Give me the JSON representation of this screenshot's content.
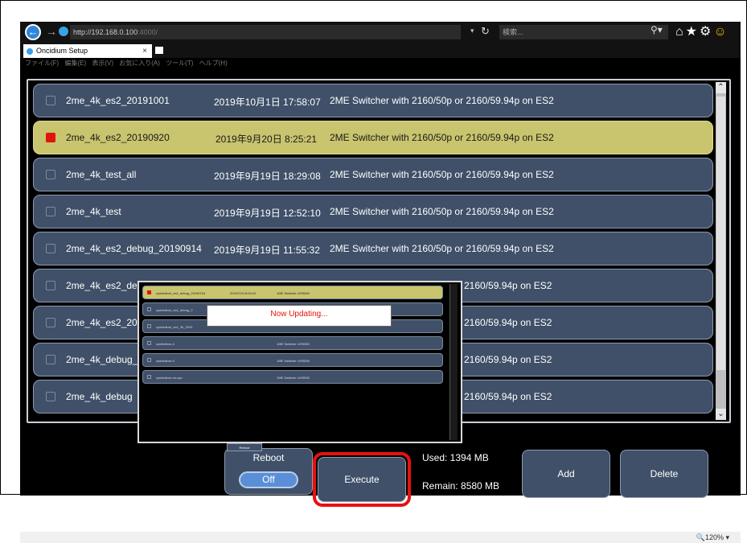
{
  "browser": {
    "url_host": "http://192.168.0.100",
    "url_rest": ":4000/",
    "search_placeholder": "検索...",
    "tab_title": "Oncidium Setup",
    "tab_close": "×",
    "menu": [
      "ファイル(F)",
      "編集(E)",
      "表示(V)",
      "お気に入り(A)",
      "ツール(T)",
      "ヘルプ(H)"
    ],
    "toolbar_icons": [
      "home-icon",
      "star-icon",
      "gear-icon",
      "smiley-icon"
    ],
    "zoom": "120%"
  },
  "list": {
    "rows": [
      {
        "name": "2me_4k_es2_20191001",
        "date": "2019年10月1日 17:58:07",
        "desc": "2ME Switcher with 2160/50p or 2160/59.94p on ES2",
        "selected": false
      },
      {
        "name": "2me_4k_es2_20190920",
        "date": "2019年9月20日 8:25:21",
        "desc": "2ME Switcher with 2160/50p or 2160/59.94p on ES2",
        "selected": true
      },
      {
        "name": "2me_4k_test_all",
        "date": "2019年9月19日 18:29:08",
        "desc": "2ME Switcher with 2160/50p or 2160/59.94p on ES2",
        "selected": false
      },
      {
        "name": "2me_4k_test",
        "date": "2019年9月19日 12:52:10",
        "desc": "2ME Switcher with 2160/50p or 2160/59.94p on ES2",
        "selected": false
      },
      {
        "name": "2me_4k_es2_debug_20190914",
        "date": "2019年9月19日 11:55:32",
        "desc": "2ME Switcher with 2160/50p or 2160/59.94p on ES2",
        "selected": false
      },
      {
        "name": "2me_4k_es2_de",
        "date": "",
        "desc": "2160/59.94p on ES2",
        "selected": false
      },
      {
        "name": "2me_4k_es2_20",
        "date": "",
        "desc": "2160/59.94p on ES2",
        "selected": false
      },
      {
        "name": "2me_4k_debug_",
        "date": "",
        "desc": "2160/59.94p on ES2",
        "selected": false
      },
      {
        "name": "2me_4k_debug",
        "date": "",
        "desc": "2160/59.94p on ES2",
        "selected": false
      }
    ]
  },
  "overlay": {
    "updating_text": "Now Updating...",
    "rows": [
      {
        "name": "cymbidium_es1_debug_20190724",
        "date": "2019/7/24 8:26:10",
        "desc": "1ME Switcher UHS500",
        "selected": true
      },
      {
        "name": "cymbidium_es1_debug_2",
        "date": "",
        "desc": "",
        "selected": false
      },
      {
        "name": "cymbidium_es1_3k_2019",
        "date": "",
        "desc": "",
        "selected": false
      },
      {
        "name": "cymbidium-4",
        "date": "",
        "desc": "1ME Switcher UHS500",
        "selected": false
      },
      {
        "name": "cymbidium-5",
        "date": "",
        "desc": "1ME Switcher UHS500",
        "selected": false
      },
      {
        "name": "cymbidium-no-opc",
        "date": "",
        "desc": "1ME Switcher UHS500",
        "selected": false
      }
    ],
    "reboot_tab": "Reboot"
  },
  "controls": {
    "reboot_label": "Reboot",
    "reboot_toggle": "Off",
    "execute_label": "Execute",
    "used": "Used: 1394 MB",
    "remain": "Remain: 8580 MB",
    "add_label": "Add",
    "delete_label": "Delete"
  }
}
